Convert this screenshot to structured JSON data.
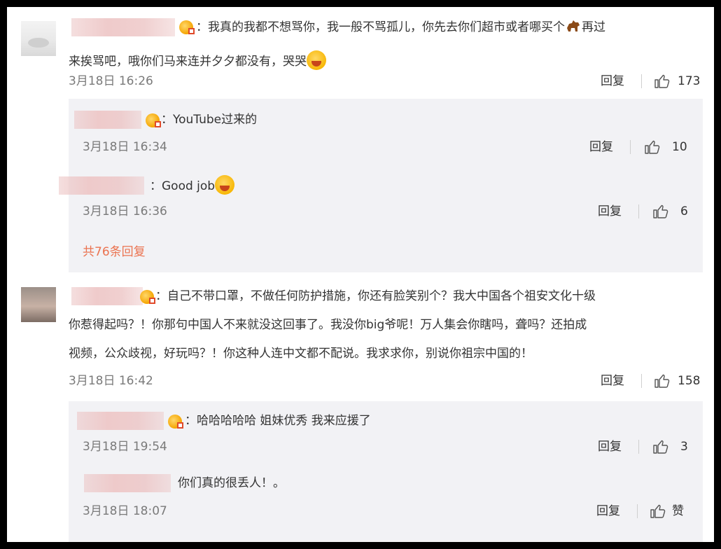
{
  "comments": [
    {
      "text_line1": "：我真的我都不想骂你，我一般不骂孤儿，你先去你们超市或者哪买个",
      "text_line1_end": "再过",
      "text_line2": "来挨骂吧，哦你们马来连并夕夕都没有，哭哭",
      "time": "3月18日 16:26",
      "reply_label": "回复",
      "like_count": "173",
      "replies": [
        {
          "text": "：YouTube过来的",
          "time": "3月18日 16:34",
          "reply_label": "回复",
          "like_count": "10"
        },
        {
          "text": "：Good job",
          "time": "3月18日 16:36",
          "reply_label": "回复",
          "like_count": "6"
        }
      ],
      "more_replies": "共76条回复"
    },
    {
      "text_line1": "：自己不带口罩，不做任何防护措施，你还有脸笑别个？我大中国各个祖安文化十级",
      "text_line2": "你惹得起吗？！你那句中国人不来就没这回事了。我没你big爷呢！万人集会你瞎吗，聋吗？还拍成",
      "text_line3": "视频，公众歧视，好玩吗？！你这种人连中文都不配说。我求求你，别说你祖宗中国的！",
      "time": "3月18日 16:42",
      "reply_label": "回复",
      "like_count": "158",
      "replies": [
        {
          "text": "：哈哈哈哈哈 姐妹优秀 我来应援了",
          "time": "3月18日 19:54",
          "reply_label": "回复",
          "like_count": "3"
        },
        {
          "text": "你们真的很丢人！。",
          "time": "3月18日 18:07",
          "reply_label": "回复",
          "like_count": "赞"
        }
      ]
    }
  ],
  "colors": {
    "more_link": "#eb7350",
    "reply_bg": "#f2f2f5",
    "time": "#7a7a7a"
  }
}
